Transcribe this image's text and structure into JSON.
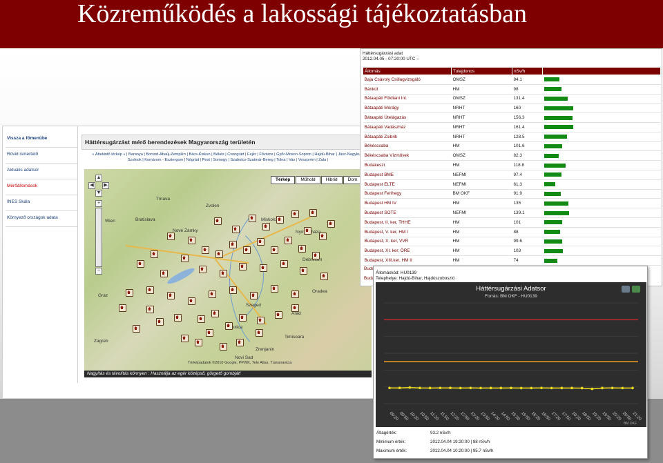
{
  "slide": {
    "title": "Közreműködés a lakossági tájékoztatásban",
    "colors": {
      "header": "#7f0000",
      "accent": "#138a13"
    }
  },
  "site": {
    "sidebar": [
      "Vissza a főmenübe",
      "Rövid ismertető",
      "Aktuális adatsor",
      "Mérőállomások",
      "INES Skála",
      "Környező országok adata"
    ],
    "active_item": "Mérőállomások",
    "map_title": "Háttérsugárzást mérő berendezések Magyarország területén",
    "region_links": "« Áttekintő térkép « | Baranya | Borsod-Abaúj-Zemplén | Bács-Kiskun | Békés | Csongrád | Fejér | Főváros | Győr-Moson-Sopron | Hajdú-Bihar | Jász-Nagykun-Szolnok | Komárom - Esztergom | Nógrád | Pest | Somogy | Szabolcs-Szatmár-Bereg | Tolna | Vas | Veszprém | Zala |",
    "map_buttons": [
      "Térkép",
      "Műhold",
      "Hibrid",
      "Dom"
    ],
    "map_attribution": "Térképadatok ©2010 Google, PPWK, Tele Atlas, Transnavicia",
    "zoom_note": "Nagyítás és távolítás könnyen : Használja az egér középső, görgető gombját!",
    "map_controls": [
      "up-arrow-icon",
      "left-arrow-icon",
      "right-arrow-icon",
      "down-arrow-icon",
      "zoom-in-icon",
      "zoom-out-icon"
    ],
    "cities": [
      "Wien",
      "Bratislava",
      "Nové Zámky",
      "Trnava",
      "Zvolen",
      "Nyíregyháza",
      "Miskolc",
      "Debrecen",
      "Szeged",
      "Subotica",
      "Zagreb",
      "Novi Sad",
      "Timisoara",
      "Arad",
      "Oradea",
      "Graz",
      "Zrenjanin"
    ]
  },
  "station_table": {
    "title": "Háttérsugárzási adat",
    "timestamp": "2012.04.05 - 07:20:00 UTC",
    "timestamp_suffix": "--",
    "headers": [
      "Állomás",
      "Tulajdonos",
      "nSv/h",
      ""
    ],
    "rows": [
      {
        "station": "Baja Csávoly Csillagvizsgáló",
        "owner": "OMSZ",
        "value": 84.1
      },
      {
        "station": "Bánkút",
        "owner": "HM",
        "value": 98
      },
      {
        "station": "Bátaapáti Földtani Int.",
        "owner": "OMSZ",
        "value": 131.4
      },
      {
        "station": "Bátaapáti Mórágy",
        "owner": "NRHT",
        "value": 160
      },
      {
        "station": "Bátaapáti Ütelágazás",
        "owner": "NRHT",
        "value": 156.3
      },
      {
        "station": "Bátaapáti Vadászház",
        "owner": "NRHT",
        "value": 161.4
      },
      {
        "station": "Bátaapáti Zsibrik",
        "owner": "NRHT",
        "value": 128.5
      },
      {
        "station": "Békéscsaba",
        "owner": "HM",
        "value": 101.6
      },
      {
        "station": "Békéscsaba Vízművek",
        "owner": "OMSZ",
        "value": 82.3
      },
      {
        "station": "Budakeszi",
        "owner": "HM",
        "value": 118.8
      },
      {
        "station": "Budapest BME",
        "owner": "NEFMI",
        "value": 97.4
      },
      {
        "station": "Budapest ELTE",
        "owner": "NEFMI",
        "value": 61.3
      },
      {
        "station": "Budapest Ferihegy",
        "owner": "BM OKF",
        "value": 91.9
      },
      {
        "station": "Budapest HM IV",
        "owner": "HM",
        "value": 135
      },
      {
        "station": "Budapest SOTE",
        "owner": "NEFMI",
        "value": 139.1
      },
      {
        "station": "Budapest, II. ker, THHE",
        "owner": "HM",
        "value": 101
      },
      {
        "station": "Budapest, V. ker, HM I",
        "owner": "HM",
        "value": 88
      },
      {
        "station": "Budapest, X. ker, VVR",
        "owner": "HM",
        "value": 99.6
      },
      {
        "station": "Budapest, XI. ker, ÖRE",
        "owner": "HM",
        "value": 103
      },
      {
        "station": "Budapest, XIII.ker, HM II",
        "owner": "HM",
        "value": 74
      }
    ],
    "tail_rows": [
      "Buda",
      "Buda"
    ]
  },
  "chart_panel": {
    "station_code_label": "Állomáskód: HU0139",
    "station_site_label": "Telephelye: Hajdú-Bihar, Hajdúszoboszló",
    "icons": [
      "print-icon",
      "download-icon"
    ],
    "credit": "BM OKF",
    "stats": [
      {
        "label": "Átlagérték:",
        "value": "93.2 nSv/h"
      },
      {
        "label": "Minimum érték:",
        "value": "2012.04.04 19:20:00 | 88 nSv/h"
      },
      {
        "label": "Maximum érték:",
        "value": "2012.04.04 10:20:00 | 95.7 nSv/h"
      }
    ]
  },
  "chart_data": {
    "type": "line",
    "title": "Háttérsugárzási Adatsor",
    "subtitle": "Forrás: BM OKF - HU0139",
    "x": [
      "09:20",
      "09:50",
      "10:20",
      "10:50",
      "11:20",
      "11:50",
      "12:20",
      "12:50",
      "13:20",
      "13:50",
      "14:20",
      "14:50",
      "15:20",
      "15:50",
      "16:20",
      "16:50",
      "17:20",
      "17:50",
      "18:20",
      "18:50",
      "19:20",
      "19:50",
      "20:20",
      "20:50",
      "21:20"
    ],
    "series": [
      {
        "color": "#f0e020",
        "values": [
          93.5,
          93.6,
          95.7,
          93.4,
          93.1,
          93.3,
          93.6,
          93.0,
          93.4,
          92.8,
          93.2,
          93.1,
          93.4,
          92.9,
          93.0,
          93.3,
          92.8,
          93.1,
          93.2,
          92.7,
          88.0,
          93.1,
          93.4,
          93.0,
          93.2
        ]
      }
    ],
    "reference_lines": [
      {
        "color": "#c0282b",
        "value": 500
      },
      {
        "color": "#f0a020",
        "value": 250
      }
    ],
    "ylim": [
      0,
      600
    ],
    "grid": true
  }
}
